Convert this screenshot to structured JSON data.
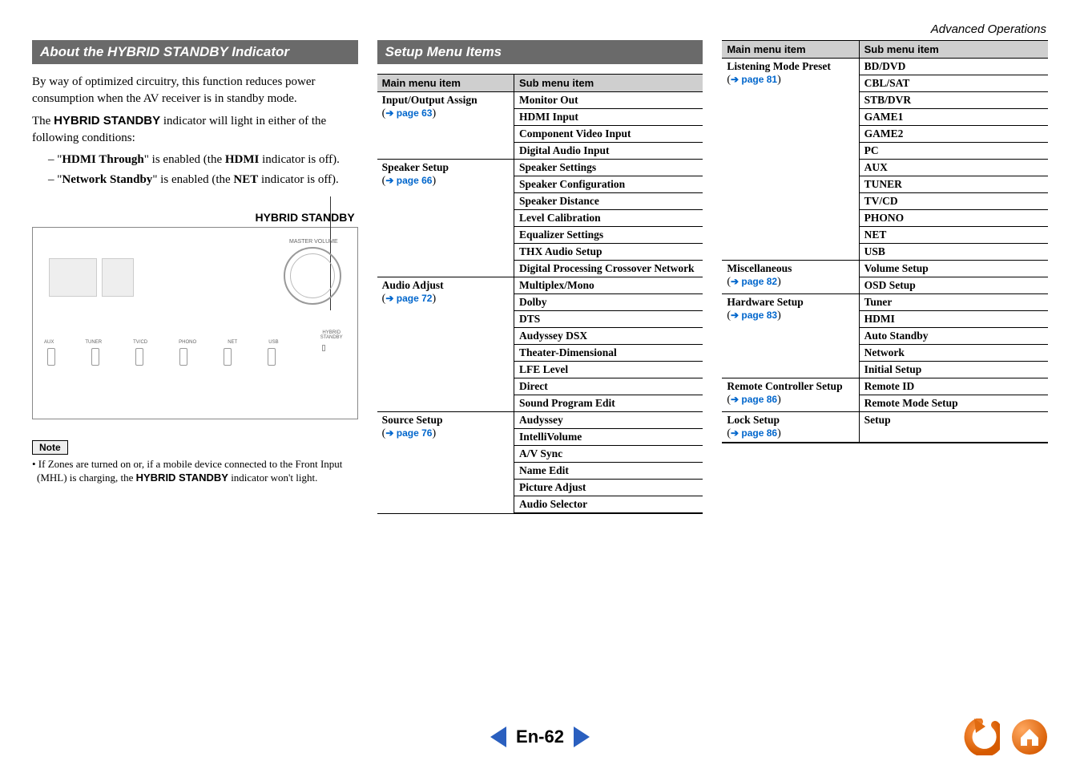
{
  "header": {
    "section_title": "Advanced Operations"
  },
  "col1": {
    "bar": "About the HYBRID STANDBY Indicator",
    "p1a": "By way of optimized circuitry, this function reduces power consumption when the AV receiver is in standby mode.",
    "p1b_prefix": "The ",
    "p1b_bold": "HYBRID STANDBY",
    "p1b_suffix": " indicator will light in either of the following conditions:",
    "li1_a": "\"",
    "li1_b": "HDMI Through",
    "li1_c": "\" is enabled (the ",
    "li1_d": "HDMI",
    "li1_e": " indicator is off).",
    "li2_a": "\"",
    "li2_b": "Network Standby",
    "li2_c": "\" is enabled (the ",
    "li2_d": "NET",
    "li2_e": " indicator is off).",
    "standby_label": "HYBRID STANDBY",
    "panel": {
      "knob_label": "MASTER VOLUME",
      "btns": [
        "AUX",
        "TUNER",
        "TV/CD",
        "PHONO",
        "NET",
        "USB"
      ],
      "hs": "HYBRID\nSTANDBY"
    },
    "note_label": "Note",
    "note_bullet_a": "• If Zones are turned on or, if a mobile device connected to the Front Input (MHL) is charging, the ",
    "note_bullet_b": "HYBRID STANDBY",
    "note_bullet_c": " indicator won't light."
  },
  "col2": {
    "bar": "Setup Menu Items",
    "th_main": "Main menu item",
    "th_sub": "Sub menu item",
    "groups": [
      {
        "main": "Input/Output Assign",
        "page": "page 63",
        "subs": [
          "Monitor Out",
          "HDMI Input",
          "Component Video Input",
          "Digital Audio Input"
        ]
      },
      {
        "main": "Speaker Setup",
        "page": "page 66",
        "subs": [
          "Speaker Settings",
          "Speaker Configuration",
          "Speaker Distance",
          "Level Calibration",
          "Equalizer Settings",
          "THX Audio Setup",
          "Digital Processing Crossover Network"
        ]
      },
      {
        "main": "Audio Adjust",
        "page": "page 72",
        "subs": [
          "Multiplex/Mono",
          "Dolby",
          "DTS",
          "Audyssey DSX",
          "Theater-Dimensional",
          "LFE Level",
          "Direct",
          "Sound Program Edit"
        ]
      },
      {
        "main": "Source Setup",
        "page": "page 76",
        "subs": [
          "Audyssey",
          "IntelliVolume",
          "A/V Sync",
          "Name Edit",
          "Picture Adjust",
          "Audio Selector"
        ]
      }
    ]
  },
  "col3": {
    "th_main": "Main menu item",
    "th_sub": "Sub menu item",
    "groups": [
      {
        "main": "Listening Mode Preset",
        "page": "page 81",
        "subs": [
          "BD/DVD",
          "CBL/SAT",
          "STB/DVR",
          "GAME1",
          "GAME2",
          "PC",
          "AUX",
          "TUNER",
          "TV/CD",
          "PHONO",
          "NET",
          "USB"
        ]
      },
      {
        "main": "Miscellaneous",
        "page": "page 82",
        "subs": [
          "Volume Setup",
          "OSD Setup"
        ]
      },
      {
        "main": "Hardware Setup",
        "page": "page 83",
        "subs": [
          "Tuner",
          "HDMI",
          "Auto Standby",
          "Network",
          "Initial Setup"
        ]
      },
      {
        "main": "Remote Controller Setup",
        "page": "page 86",
        "subs": [
          "Remote ID",
          "Remote Mode Setup"
        ]
      },
      {
        "main": "Lock Setup",
        "page": "page 86",
        "subs": [
          "Setup"
        ]
      }
    ]
  },
  "footer": {
    "page": "En-62"
  }
}
